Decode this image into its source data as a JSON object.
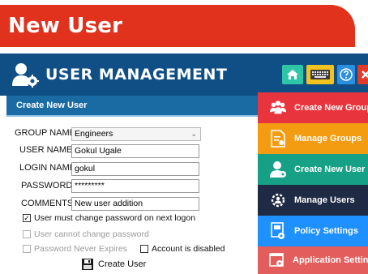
{
  "banner": {
    "title": "New User"
  },
  "app": {
    "title": "USER MANAGEMENT",
    "header_buttons": [
      "home-icon",
      "keyboard-icon",
      "help-icon",
      "close-icon"
    ],
    "colors": {
      "header": "#0f4f86",
      "banner": "#e0321c"
    }
  },
  "form": {
    "header": "Create New User",
    "group_name_label": "GROUP NAME",
    "group_name_value": "Engineers",
    "user_name_label": "USER NAME",
    "user_name_value": "Gokul Ugale",
    "login_name_label": "LOGIN NAME",
    "login_name_value": "gokul",
    "password_label": "PASSWORD",
    "password_value": "*********",
    "comments_label": "COMMENTS",
    "comments_value": "New user addition",
    "chk_must_change": "User must change password on next logon",
    "chk_cannot_change": "User cannot change password",
    "chk_never_expires": "Password Never Expires",
    "chk_disabled": "Account is disabled",
    "create_button": "Create User"
  },
  "menu": {
    "items": [
      {
        "label": "Create New Group",
        "color": "#e8343c",
        "icon": "group-icon"
      },
      {
        "label": "Manage Groups",
        "color": "#f39c12",
        "icon": "groups-document-icon"
      },
      {
        "label": "Create New User",
        "color": "#16a085",
        "icon": "add-user-icon"
      },
      {
        "label": "Manage Users",
        "color": "#1f2a44",
        "icon": "gear-users-icon"
      },
      {
        "label": "Policy Settings",
        "color": "#1e90ff",
        "icon": "policy-icon"
      },
      {
        "label": "Application Settings",
        "color": "#e35d5d",
        "icon": "settings-window-icon"
      }
    ]
  }
}
